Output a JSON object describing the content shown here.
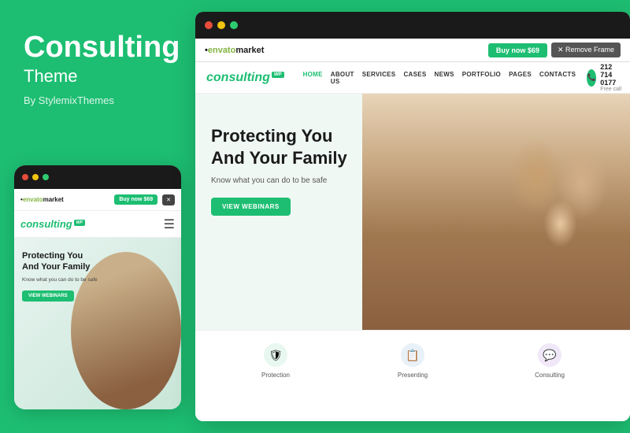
{
  "left": {
    "title": "Consulting",
    "subtitle": "Theme",
    "author": "By StylemixThemes"
  },
  "mobile": {
    "envato_label": "•envatomarket",
    "buy_label": "Buy now $69",
    "close_label": "✕",
    "logo": "consulting",
    "wp_badge": "WP",
    "hero_title": "Protecting You And Your Family",
    "hero_sub": "Know what you can do to be safe",
    "view_btn": "VIEW WEBINARS"
  },
  "desktop": {
    "envato_label": "•envatomarket",
    "buy_label": "Buy now $69",
    "remove_label": "✕ Remove Frame",
    "logo": "consulting",
    "wp_badge": "WP",
    "nav": [
      "HOME",
      "ABOUT US",
      "SERVICES",
      "CASES",
      "NEWS",
      "PORTFOLIO",
      "PAGES",
      "CONTACTS"
    ],
    "phone_number": "212 714 0177",
    "phone_free": "Free call",
    "hero_title": "Protecting You And Your Family",
    "hero_sub": "Know what you can do to be safe",
    "view_btn": "VIEW WEBINARS",
    "bottom_items": [
      {
        "icon": "🛡",
        "label": "Protection"
      },
      {
        "icon": "📋",
        "label": "Presenting"
      },
      {
        "icon": "💬",
        "label": "Consulting"
      }
    ]
  },
  "dots": {
    "red": "#e74c3c",
    "yellow": "#f1c40f",
    "green": "#2ecc71"
  }
}
